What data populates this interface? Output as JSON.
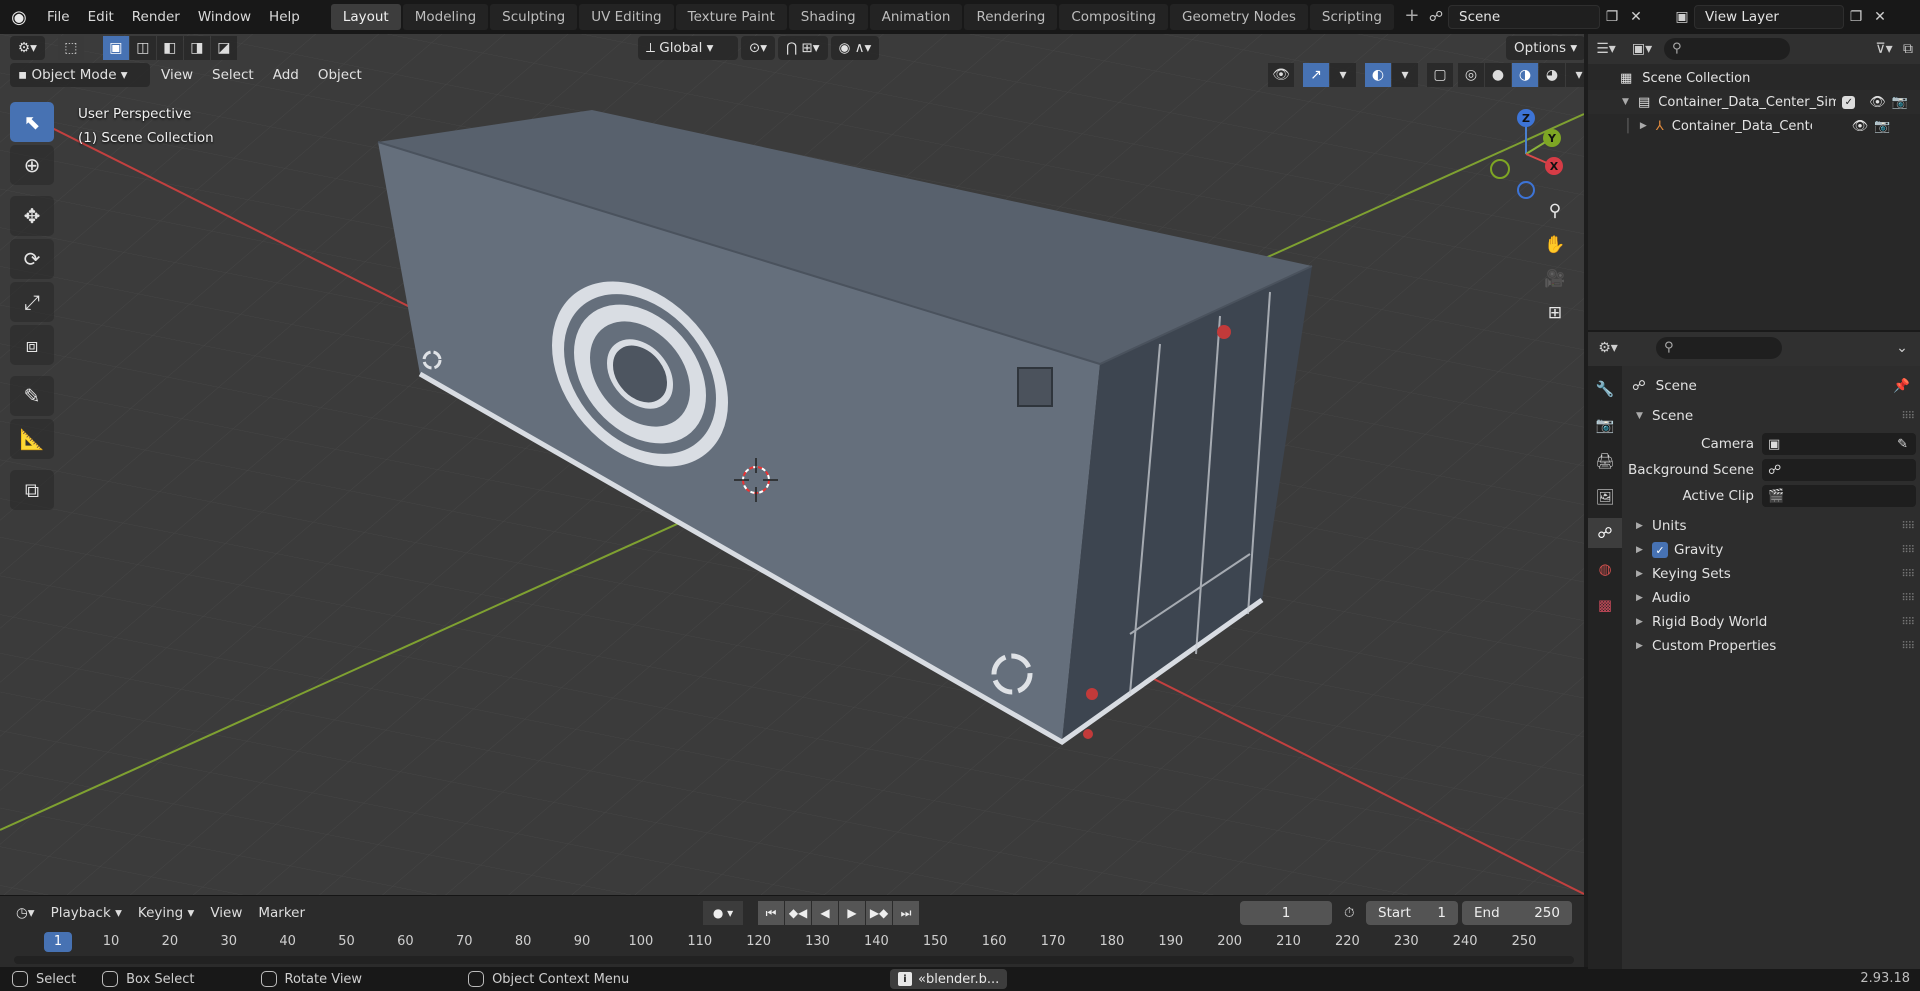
{
  "topbar": {
    "menus": [
      "File",
      "Edit",
      "Render",
      "Window",
      "Help"
    ],
    "workspaces": [
      "Layout",
      "Modeling",
      "Sculpting",
      "UV Editing",
      "Texture Paint",
      "Shading",
      "Animation",
      "Rendering",
      "Compositing",
      "Geometry Nodes",
      "Scripting"
    ],
    "active_workspace": "Layout",
    "scene_name": "Scene",
    "view_layer": "View Layer"
  },
  "viewport": {
    "mode": "Object Mode",
    "menus": [
      "View",
      "Select",
      "Add",
      "Object"
    ],
    "transform_orientation": "Global",
    "options_label": "Options",
    "overlay_line1": "User Perspective",
    "overlay_line2": "(1) Scene Collection",
    "gizmo": {
      "x": "X",
      "y": "Y",
      "z": "Z"
    }
  },
  "timeline": {
    "menus": [
      "Playback",
      "Keying",
      "View",
      "Marker"
    ],
    "current_frame": "1",
    "current_frame_field": "1",
    "start_label": "Start",
    "start_value": "1",
    "end_label": "End",
    "end_value": "250",
    "ruler": [
      "10",
      "20",
      "30",
      "40",
      "50",
      "60",
      "70",
      "80",
      "90",
      "100",
      "110",
      "120",
      "130",
      "140",
      "150",
      "160",
      "170",
      "180",
      "190",
      "200",
      "210",
      "220",
      "230",
      "240",
      "250"
    ]
  },
  "statusbar": {
    "select": "Select",
    "box_select": "Box Select",
    "rotate_view": "Rotate View",
    "context_menu": "Object Context Menu",
    "notification": "«blender.b...",
    "version": "2.93.18"
  },
  "outliner": {
    "root": "Scene Collection",
    "collection": "Container_Data_Center_Simp",
    "object": "Container_Data_Center_S"
  },
  "properties": {
    "context_title": "Scene",
    "panel_scene": "Scene",
    "camera_label": "Camera",
    "background_scene_label": "Background Scene",
    "active_clip_label": "Active Clip",
    "panels": [
      "Units",
      "Gravity",
      "Keying Sets",
      "Audio",
      "Rigid Body World",
      "Custom Properties"
    ]
  },
  "colors": {
    "accent": "#4772b3",
    "viewport_bg": "#3b3b3b",
    "axis_x": "#c2403f",
    "axis_y": "#7fa131",
    "container": "#5a6370"
  }
}
